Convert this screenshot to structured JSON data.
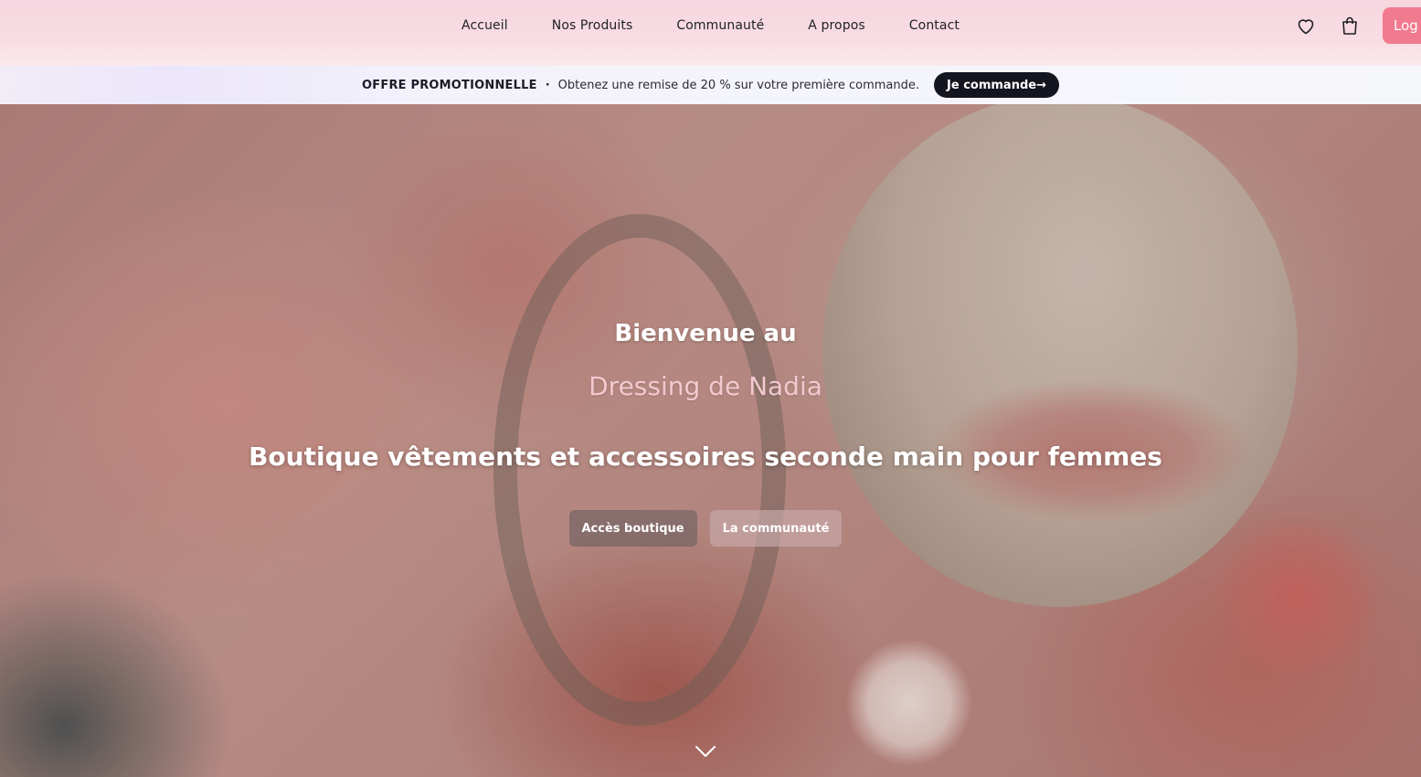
{
  "nav": {
    "links": [
      {
        "label": "Accueil"
      },
      {
        "label": "Nos Produits"
      },
      {
        "label": "Communauté"
      },
      {
        "label": "A propos"
      },
      {
        "label": "Contact"
      }
    ],
    "icons": {
      "wishlist": "heart-icon",
      "cart": "shopping-bag-icon"
    },
    "login_label": "Log"
  },
  "promo": {
    "title": "OFFRE PROMOTIONNELLE",
    "separator": "·",
    "text": "Obtenez une remise de 20 % sur votre première commande.",
    "button_label": "Je commande→"
  },
  "hero": {
    "welcome": "Bienvenue au",
    "brand": "Dressing de Nadia",
    "tagline": "Boutique vêtements et accessoires seconde main pour femmes",
    "buttons": {
      "shop": "Accès boutique",
      "community": "La communauté"
    },
    "scroll_icon": "chevron-down-icon"
  },
  "colors": {
    "accent": "#f27a8f",
    "promo_button": "#15151f",
    "brand_text": "#f2c9cf"
  }
}
